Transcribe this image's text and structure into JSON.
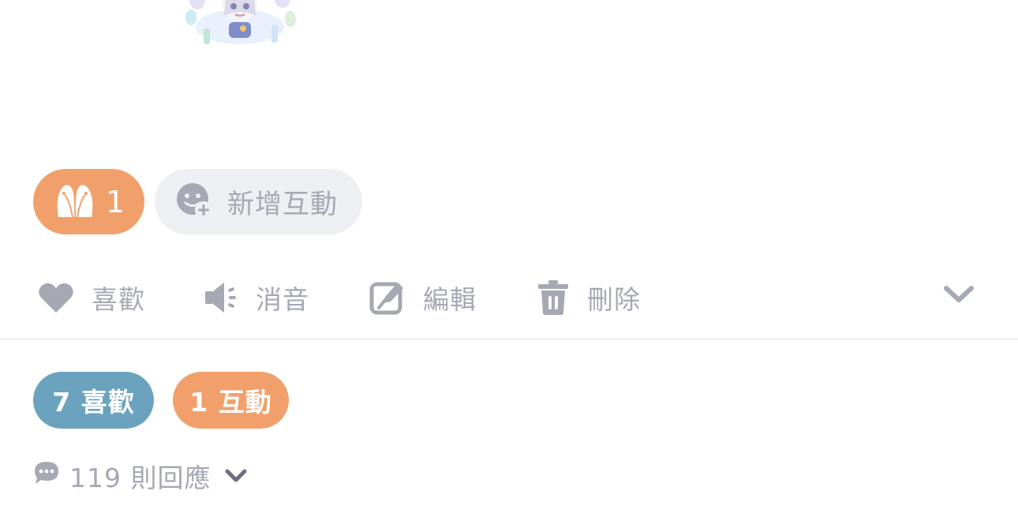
{
  "reactions": {
    "my_reaction": {
      "icon": "penguins-sticker-icon",
      "count": "1",
      "color": "#F1A06B"
    },
    "add_reaction": {
      "icon": "emoji-add-icon",
      "label": "新增互動"
    }
  },
  "actions": {
    "like": {
      "icon": "heart-icon",
      "label": "喜歡"
    },
    "mute": {
      "icon": "speaker-mute-icon",
      "label": "消音"
    },
    "edit": {
      "icon": "edit-icon",
      "label": "編輯"
    },
    "delete": {
      "icon": "trash-icon",
      "label": "刪除"
    },
    "more": {
      "icon": "chevron-down-icon"
    }
  },
  "summary": {
    "likes_label": "7 喜歡",
    "likes_color": "#6BA3BE",
    "interactions_label": "1 互動",
    "interactions_color": "#F1A06B"
  },
  "replies": {
    "icon": "chat-bubble-icon",
    "label": "119 則回應"
  },
  "colors": {
    "muted_text": "#A6A8B3",
    "chip_bg": "#EEEFF2",
    "divider": "#D9DBE1"
  }
}
